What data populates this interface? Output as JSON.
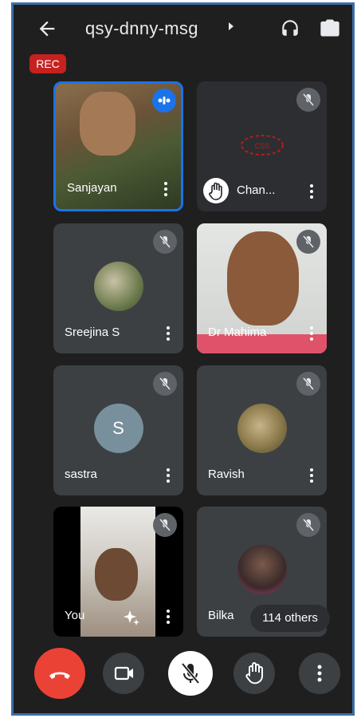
{
  "meeting": {
    "code": "qsy-dnny-msg",
    "rec_label": "REC"
  },
  "participants": [
    {
      "name": "Sanjayan",
      "type": "video",
      "active": true
    },
    {
      "name": "Chan...",
      "type": "logo",
      "muted": true,
      "hand_raised": true
    },
    {
      "name": "Sreejina S",
      "type": "avatar-photo",
      "muted": true
    },
    {
      "name": "Dr Mahima",
      "type": "video",
      "muted": true
    },
    {
      "name": "sastra",
      "type": "letter",
      "letter": "S",
      "muted": true
    },
    {
      "name": "Ravish",
      "type": "avatar-photo",
      "muted": true
    },
    {
      "name": "You",
      "type": "video",
      "muted": true
    },
    {
      "name": "Bilka",
      "type": "avatar-photo",
      "muted": true
    }
  ],
  "others_label": "114 others",
  "colors": {
    "end_call": "#ea4335",
    "rec": "#c5221f",
    "active_border": "#1a73e8",
    "background": "#1f1f1f",
    "tile": "#3c4043"
  },
  "controls": [
    "end-call-icon",
    "camera-icon",
    "mic-off-icon",
    "raise-hand-icon",
    "more-vert-icon"
  ]
}
